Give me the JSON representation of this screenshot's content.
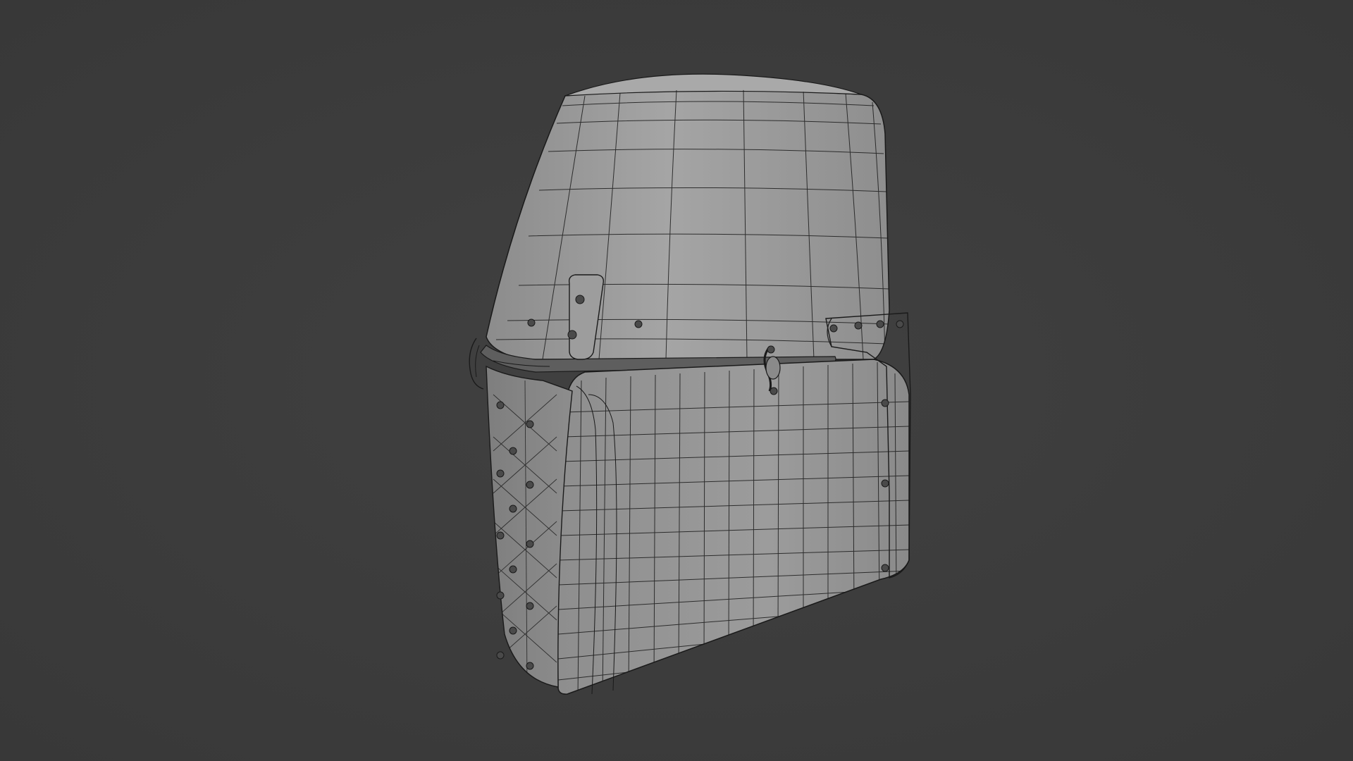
{
  "viewport": {
    "background_color": "#3d3d3d",
    "model_fill_color": "#9a9a9a",
    "wire_color": "#1a1a1a"
  },
  "model": {
    "subject": "great-helm",
    "shading": "solid-with-wireframe"
  }
}
